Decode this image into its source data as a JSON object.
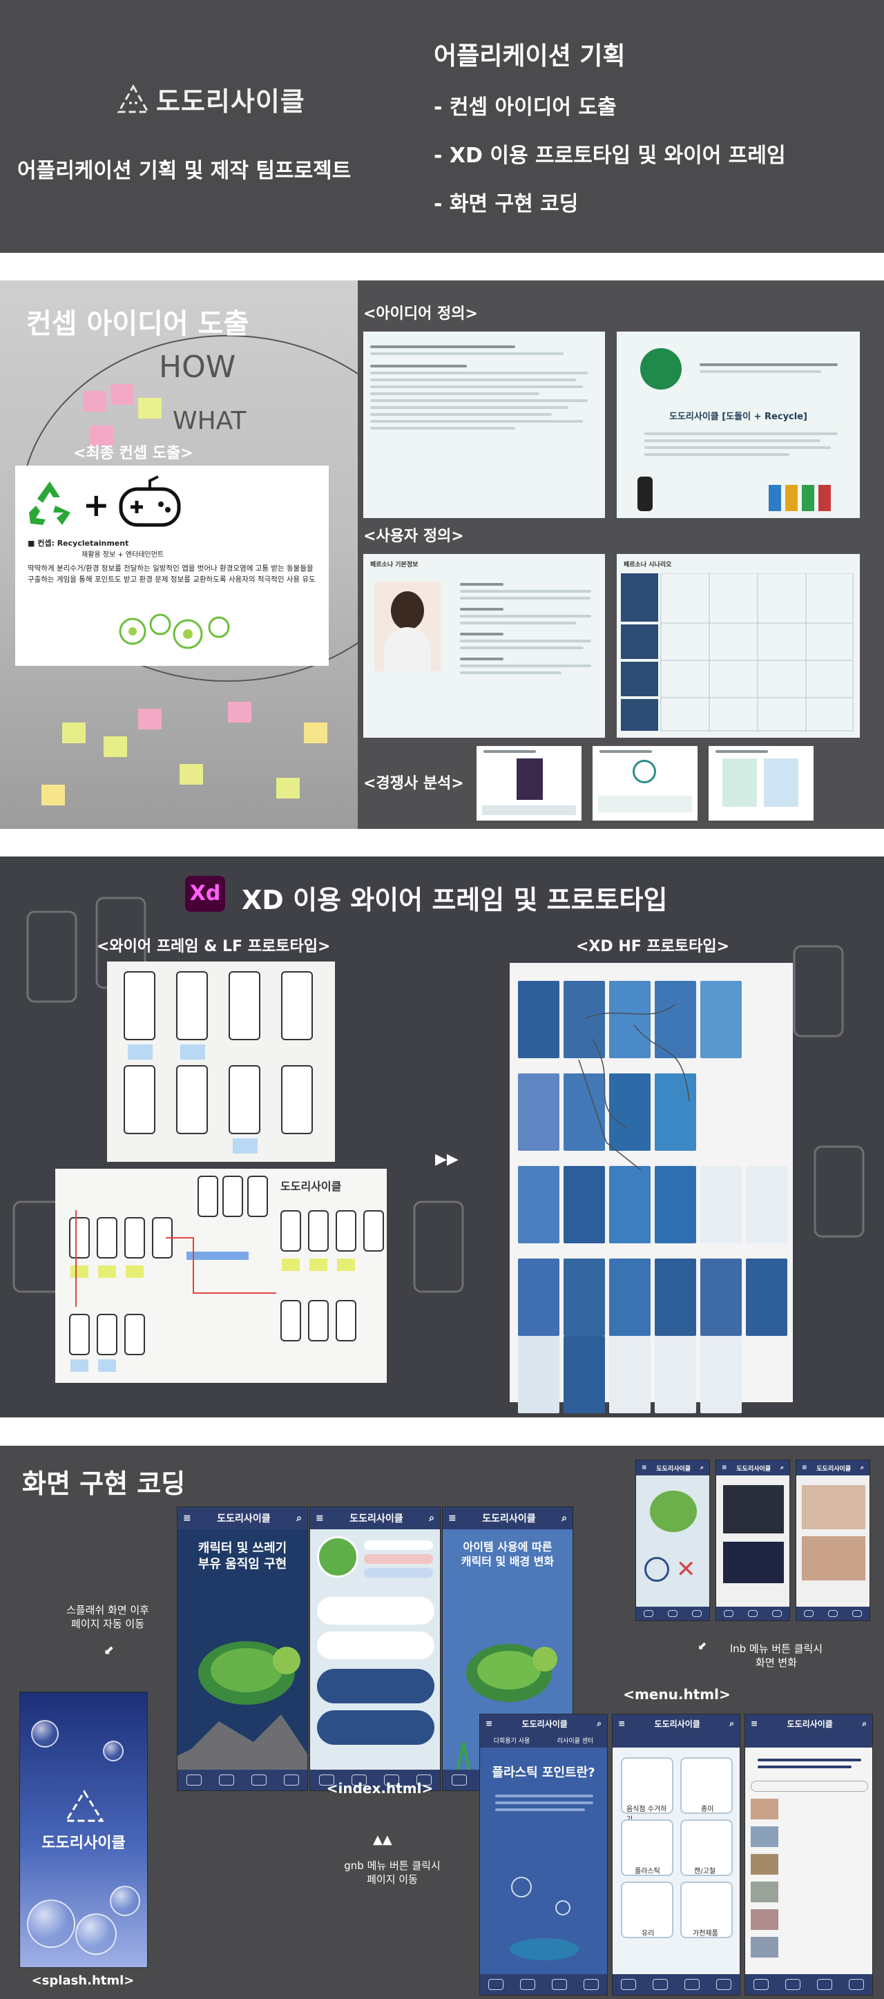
{
  "header": {
    "logo_text": "도도리사이클",
    "subtitle": "어플리케이션 기획 및 제작 팀프로젝트",
    "title": "어플리케이션 기획",
    "items": [
      "- 컨셉 아이디어 도출",
      "- XD 이용 프로토타입 및 와이어 프레임",
      "- 화면 구현 코딩"
    ]
  },
  "concept": {
    "heading": "컨셉 아이디어 도출",
    "final_label": "<최종 컨셉 도출>",
    "idea_label": "<아이디어 정의>",
    "user_label": "<사용자 정의>",
    "competitor_label": "<경쟁사 분석>",
    "card_concept": "■ 컨셉: Recycletainment",
    "card_concept_sub": "재활용 정보 + 엔터테인먼트",
    "card_body": "딱딱하게 분리수거/환경 정보를 전달하는 일방적인 앱을 벗어나 환경오염에 고통 받는 동물들을 구출하는 게임을 통해 포인트도 받고 환경 문제 정보를 교환하도록 사용자의 적극적인 사용 유도",
    "slide_brand": "도도리사이클 [도돌이 + Recycle]",
    "persona_title": "페르소나 기본정보",
    "scenario_title": "페르소나 시나리오"
  },
  "xd": {
    "icon": "Xd",
    "title": "XD 이용 와이어 프레임 및 프로토타입",
    "wire_label": "<와이어 프레임 & LF 프로토타입>",
    "hf_label": "<XD HF 프로토타입>",
    "paper_logo": "도도리사이클"
  },
  "coding": {
    "heading": "화면 구현 코딩",
    "splash_note": "스플래쉬 화면 이후\n페이지 자동 이동",
    "splash_caption": "<splash.html>",
    "index_caption": "<index.html>",
    "menu_caption": "<menu.html>",
    "lnb_note": "lnb 메뉴 버튼 클릭시\n화면 변화",
    "gnb_note": "gnb 메뉴 버튼 클릭시\n페이지 이동",
    "phone_title": "도도리사이클",
    "screen1_text": "캐릭터 및 쓰레기\n부유 움직임 구현",
    "screen3_text": "아이템 사용에 따른\n캐릭터 및 배경 변화",
    "point_title": "플라스틱 포인트란?",
    "menu_tabs": [
      "다회용기 사용",
      "리사이클 센터"
    ],
    "menu_tiles": [
      "음식점 수거하기",
      "종이",
      "플라스틱",
      "캔/고철",
      "유리",
      "가전제품"
    ]
  }
}
